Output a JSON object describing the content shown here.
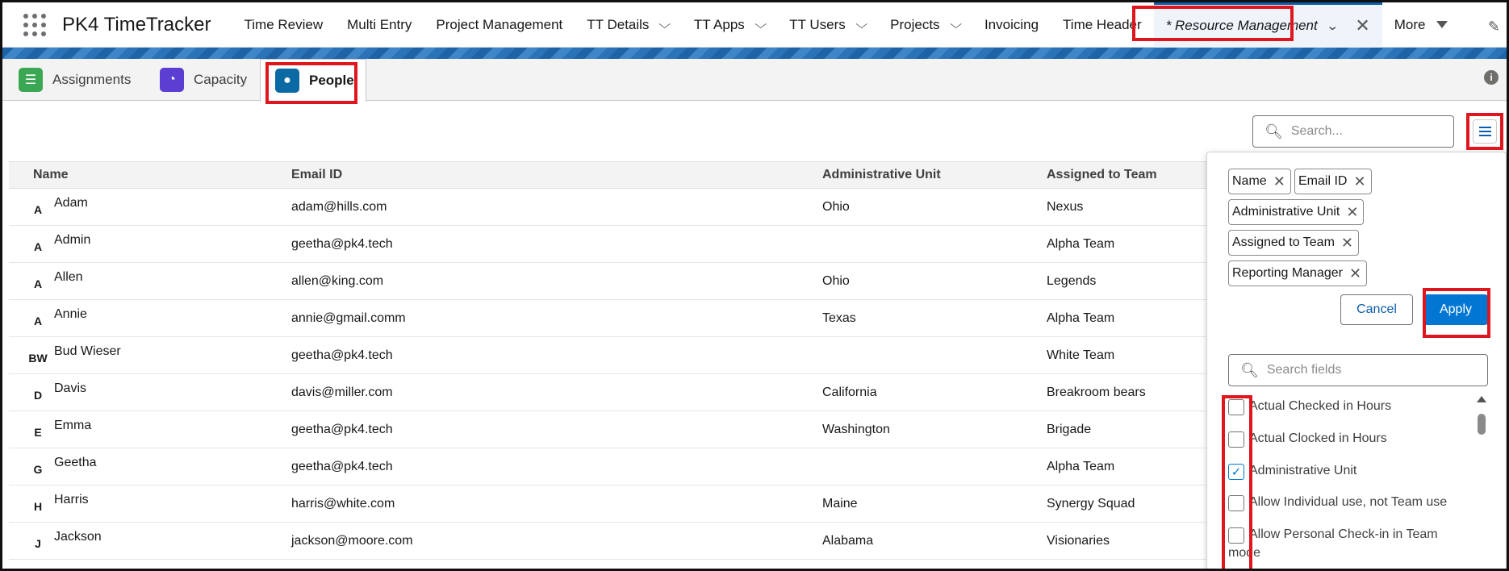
{
  "app": {
    "name": "PK4 TimeTracker"
  },
  "nav": {
    "items": [
      {
        "label": "Time Review",
        "has_menu": false
      },
      {
        "label": "Multi Entry",
        "has_menu": false
      },
      {
        "label": "Project Management",
        "has_menu": false
      },
      {
        "label": "TT Details",
        "has_menu": true
      },
      {
        "label": "TT Apps",
        "has_menu": true
      },
      {
        "label": "TT Users",
        "has_menu": true
      },
      {
        "label": "Projects",
        "has_menu": true
      },
      {
        "label": "Invoicing",
        "has_menu": false
      },
      {
        "label": "Time Header",
        "has_menu": false
      }
    ],
    "active_tab": {
      "label": "* Resource Management",
      "close": "✕",
      "chevron": "⌄"
    },
    "more_label": "More",
    "chevron": "⌵"
  },
  "subtabs": {
    "assignments": "Assignments",
    "capacity": "Capacity",
    "people": "People",
    "assignments_icon": "checklist-icon",
    "capacity_icon": "gauge-icon",
    "people_icon": "person-icon",
    "colors": {
      "assignments": "#3ba755",
      "capacity": "#5a3fd2",
      "people": "#0b6aa4"
    }
  },
  "info_icon": "i",
  "search": {
    "placeholder": "Search..."
  },
  "table": {
    "headers": {
      "name": "Name",
      "email": "Email ID",
      "unit": "Administrative Unit",
      "team": "Assigned to Team"
    },
    "rows": [
      {
        "initials": "A",
        "name": "Adam",
        "email": "adam@hills.com",
        "unit": "Ohio",
        "team": "Nexus"
      },
      {
        "initials": "A",
        "name": "Admin",
        "email": "geetha@pk4.tech",
        "unit": "",
        "team": "Alpha Team"
      },
      {
        "initials": "A",
        "name": "Allen",
        "email": "allen@king.com",
        "unit": "Ohio",
        "team": "Legends"
      },
      {
        "initials": "A",
        "name": "Annie",
        "email": "annie@gmail.comm",
        "unit": "Texas",
        "team": "Alpha Team"
      },
      {
        "initials": "BW",
        "name": "Bud Wieser",
        "email": "geetha@pk4.tech",
        "unit": "",
        "team": "White Team"
      },
      {
        "initials": "D",
        "name": "Davis",
        "email": "davis@miller.com",
        "unit": "California",
        "team": "Breakroom bears"
      },
      {
        "initials": "E",
        "name": "Emma",
        "email": "geetha@pk4.tech",
        "unit": "Washington",
        "team": "Brigade"
      },
      {
        "initials": "G",
        "name": "Geetha",
        "email": "geetha@pk4.tech",
        "unit": "",
        "team": "Alpha Team"
      },
      {
        "initials": "H",
        "name": "Harris",
        "email": "harris@white.com",
        "unit": "Maine",
        "team": "Synergy Squad"
      },
      {
        "initials": "J",
        "name": "Jackson",
        "email": "jackson@moore.com",
        "unit": "Alabama",
        "team": "Visionaries"
      }
    ]
  },
  "panel": {
    "selected": [
      "Name",
      "Email ID",
      "Administrative Unit",
      "Assigned to Team",
      "Reporting Manager"
    ],
    "remove_symbol": "✕",
    "cancel_label": "Cancel",
    "apply_label": "Apply",
    "field_search_placeholder": "Search fields",
    "fields": [
      {
        "label": "Actual Checked in Hours",
        "checked": false
      },
      {
        "label": "Actual Clocked in Hours",
        "checked": false
      },
      {
        "label": "Administrative Unit",
        "checked": true
      },
      {
        "label": "Allow Individual use, not Team use",
        "checked": false
      },
      {
        "label": "Allow Personal Check-in in Team",
        "label_cont": "mode",
        "checked": false
      }
    ]
  },
  "colors": {
    "brand_blue": "#0176d3",
    "highlight_red": "#e0161e"
  }
}
